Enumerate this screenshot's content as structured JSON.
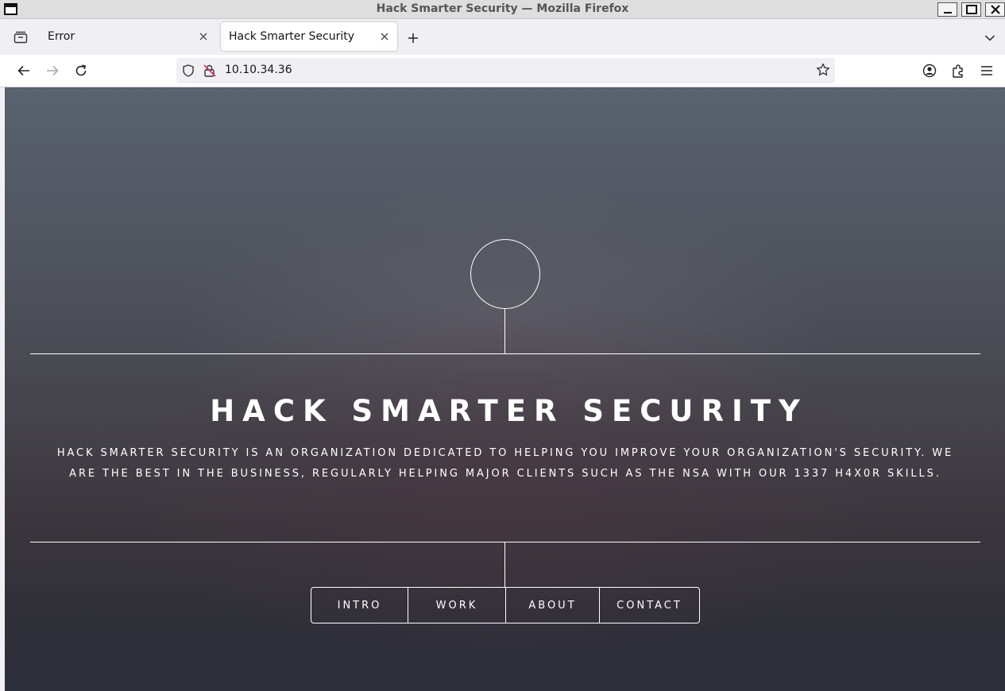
{
  "window": {
    "title": "Hack Smarter Security — Mozilla Firefox"
  },
  "tabs": [
    {
      "label": "Error",
      "active": false
    },
    {
      "label": "Hack Smarter Security",
      "active": true
    }
  ],
  "navbar": {
    "url": "10.10.34.36",
    "icons": [
      "back-icon",
      "forward-icon",
      "reload-icon",
      "shield-icon",
      "insecure-lock-icon",
      "bookmark-star-icon",
      "account-icon",
      "extensions-icon",
      "menu-icon"
    ]
  },
  "page": {
    "title": "HACK SMARTER SECURITY",
    "tagline": "HACK SMARTER SECURITY IS AN ORGANIZATION DEDICATED TO HELPING YOU IMPROVE YOUR ORGANIZATION'S SECURITY. WE ARE THE BEST IN THE BUSINESS, REGULARLY HELPING MAJOR CLIENTS SUCH AS THE NSA WITH OUR 1337 H4X0R SKILLS.",
    "nav": [
      {
        "label": "INTRO"
      },
      {
        "label": "WORK"
      },
      {
        "label": "ABOUT"
      },
      {
        "label": "CONTACT"
      }
    ]
  },
  "colors": {
    "page_bg_top": "#59626f",
    "page_bg_bottom": "#2c2e3a",
    "page_text": "#ffffff",
    "chrome_bg": "#f0f0f4"
  }
}
